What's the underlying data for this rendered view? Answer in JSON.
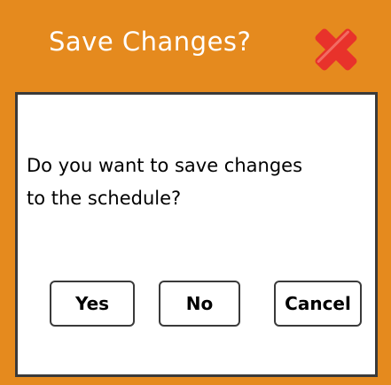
{
  "dialog": {
    "title": "Save Changes?",
    "close_icon": "close-x-icon",
    "message_line1": "Do you want to save changes",
    "message_line2": "to the schedule?",
    "buttons": {
      "yes": "Yes",
      "no": "No",
      "cancel": "Cancel"
    }
  },
  "colors": {
    "title_bar": "#e58a1e",
    "close_icon": "#e8322b",
    "panel_background": "#ffffff",
    "border": "#3a3a3a"
  }
}
